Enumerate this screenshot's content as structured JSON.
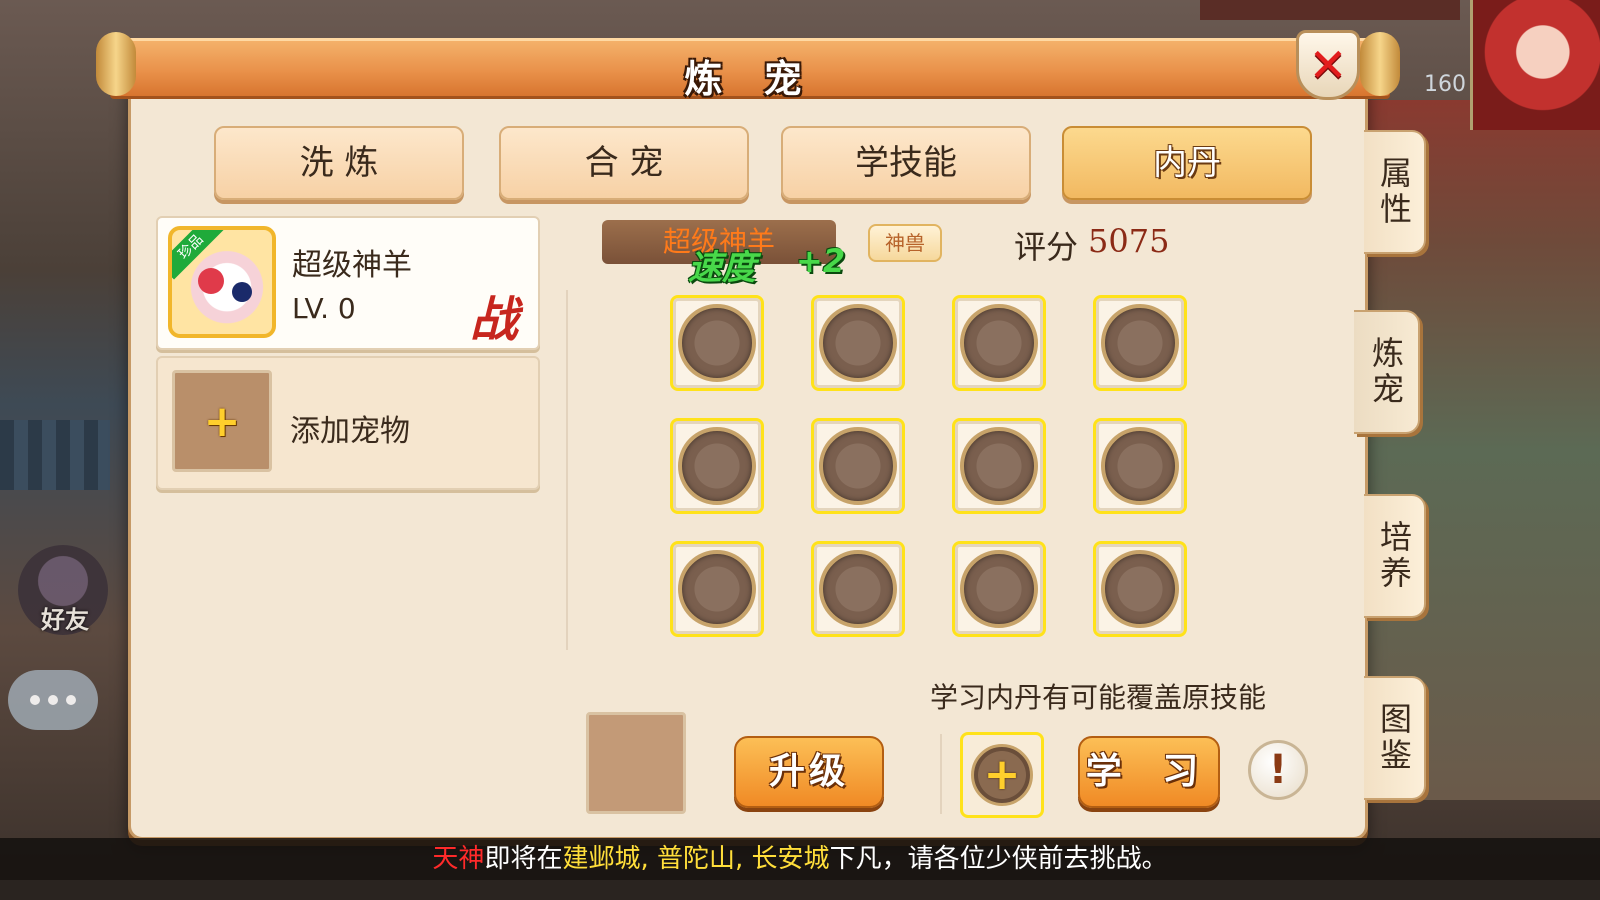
{
  "window": {
    "title": "炼 宠",
    "close_symbol": "✕"
  },
  "tabs": [
    {
      "label": "洗 炼",
      "active": false
    },
    {
      "label": "合 宠",
      "active": false
    },
    {
      "label": "学技能",
      "active": false
    },
    {
      "label": "内丹",
      "active": true
    }
  ],
  "side_tabs": [
    {
      "label": "属性",
      "active": false
    },
    {
      "label": "炼宠",
      "active": true
    },
    {
      "label": "培养",
      "active": false
    },
    {
      "label": "图鉴",
      "active": false
    }
  ],
  "pet_list": {
    "selected_pet": {
      "name": "超级神羊",
      "level": "LV. 0",
      "badge": "珍品",
      "battle_mark": "战"
    },
    "add_pet_label": "添加宠物",
    "add_icon": "plus-icon"
  },
  "pet_detail": {
    "name_plate": "超级神羊",
    "float_stat": "速度",
    "float_value": "+2",
    "type_badge": "神兽",
    "score_label": "评分",
    "score_value": "5075"
  },
  "dan_slots_count": 12,
  "bottom": {
    "hint": "学习内丹有可能覆盖原技能",
    "upgrade_button": "升级",
    "learn_button": "学 习",
    "add_dan_symbol": "+",
    "info_symbol": "!"
  },
  "background": {
    "level_number": "160",
    "friend_label": "好友"
  },
  "ticker": {
    "part1": "天神",
    "part2": "即将在",
    "part3": "建邺城",
    "part4": ", ",
    "part5": "普陀山",
    "part6": ", ",
    "part7": "长安城",
    "part8": "下凡，请各位少侠前去挑战。"
  },
  "colors": {
    "accent_orange": "#f08a25",
    "slot_border": "#ffe21a",
    "close_red": "#e21d1d",
    "score_red": "#8b2a16"
  }
}
